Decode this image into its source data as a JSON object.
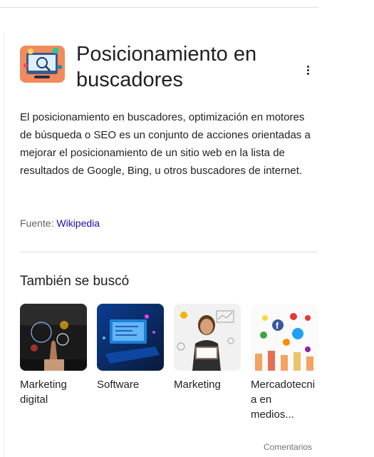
{
  "panel": {
    "title": "Posicionamiento en buscadores",
    "description": "El posicionamiento en buscadores, optimización en motores de búsqueda o SEO es un conjunto de acciones orientadas a mejorar el posicionamiento de un sitio web en la lista de resultados de Google, Bing, u otros buscadores de internet.",
    "source_prefix": "Fuente: ",
    "source_link": "Wikipedia",
    "more_icon": "more-vert-icon"
  },
  "related": {
    "title": "También se buscó",
    "items": [
      {
        "label": "Marketing digital"
      },
      {
        "label": "Software"
      },
      {
        "label": "Marketing"
      },
      {
        "label": "Mercadotecnia en medios..."
      }
    ]
  },
  "footer": {
    "feedback_label": "Comentarios"
  },
  "colors": {
    "link": "#1a0dab",
    "text": "#202124",
    "secondary": "#5f6368",
    "thumb_bg": "#f28b5b"
  }
}
